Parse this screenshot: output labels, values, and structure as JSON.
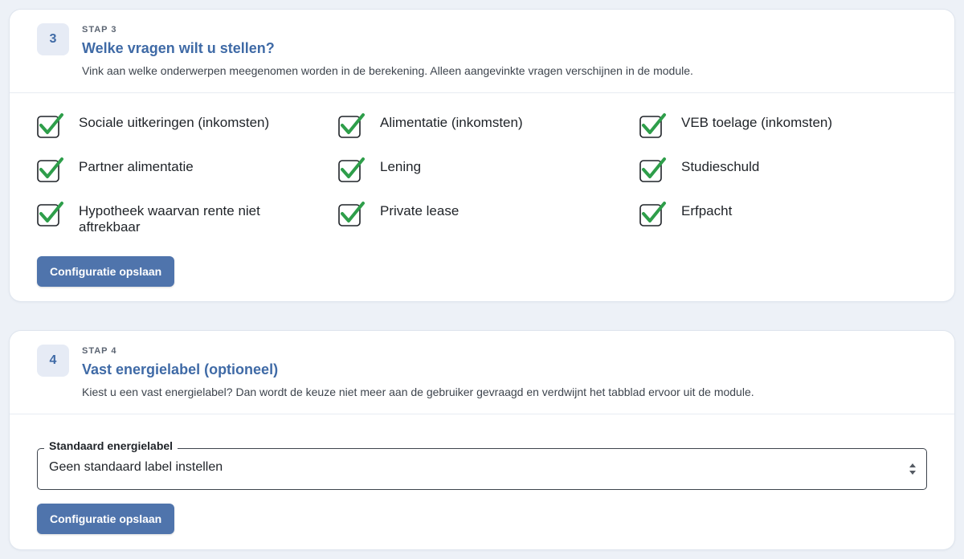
{
  "step3": {
    "number": "3",
    "label": "STAP 3",
    "title": "Welke vragen wilt u stellen?",
    "description": "Vink aan welke onderwerpen meegenomen worden in de berekening. Alleen aangevinkte vragen verschijnen in de module.",
    "options": [
      {
        "label": "Sociale uitkeringen (inkomsten)",
        "checked": true
      },
      {
        "label": "Alimentatie (inkomsten)",
        "checked": true
      },
      {
        "label": "VEB toelage (inkomsten)",
        "checked": true
      },
      {
        "label": "Partner alimentatie",
        "checked": true
      },
      {
        "label": "Lening",
        "checked": true
      },
      {
        "label": "Studieschuld",
        "checked": true
      },
      {
        "label": "Hypotheek waarvan rente niet aftrekbaar",
        "checked": true
      },
      {
        "label": "Private lease",
        "checked": true
      },
      {
        "label": "Erfpacht",
        "checked": true
      }
    ],
    "save_label": "Configuratie opslaan"
  },
  "step4": {
    "number": "4",
    "label": "STAP 4",
    "title": "Vast energielabel (optioneel)",
    "description": "Kiest u een vast energielabel? Dan wordt de keuze niet meer aan de gebruiker gevraagd en verdwijnt het tabblad ervoor uit de module.",
    "select_label": "Standaard energielabel",
    "select_value": "Geen standaard label instellen",
    "save_label": "Configuratie opslaan"
  },
  "colors": {
    "accent": "#3f6aa6",
    "button": "#4f74ac",
    "check": "#2e9e4a",
    "background": "#edf1f7"
  }
}
